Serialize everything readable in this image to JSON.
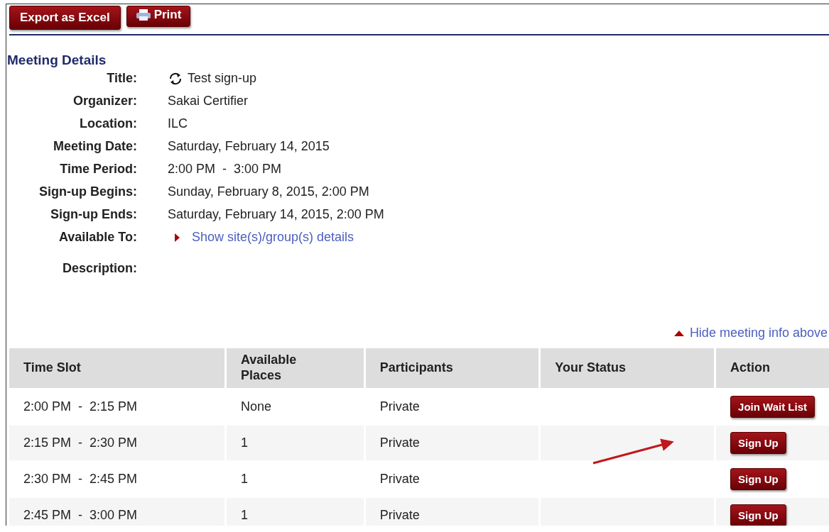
{
  "toolbar": {
    "buttons": [
      {
        "label": "Export as Excel",
        "kind": "plain"
      },
      {
        "label": "Print",
        "kind": "print"
      }
    ]
  },
  "meeting_details": {
    "heading": "Meeting Details",
    "fields": [
      {
        "label": "Title:",
        "value": "Test sign-up",
        "kind": "recurring"
      },
      {
        "label": "Organizer:",
        "value": "Sakai Certifier",
        "kind": "text"
      },
      {
        "label": "Location:",
        "value": "ILC",
        "kind": "text"
      },
      {
        "label": "Meeting Date:",
        "value": "Saturday, February 14, 2015",
        "kind": "text"
      },
      {
        "label": "Time Period:",
        "value": "2:00 PM  -  3:00 PM",
        "kind": "text"
      },
      {
        "label": "Sign-up Begins:",
        "value": "Sunday, February 8, 2015, 2:00 PM",
        "kind": "text"
      },
      {
        "label": "Sign-up Ends:",
        "value": "Saturday, February 14, 2015, 2:00 PM",
        "kind": "text"
      },
      {
        "label": "Available To:",
        "value": "Show site(s)/group(s) details",
        "kind": "toggle",
        "expanded": false
      },
      {
        "label": "Description:",
        "kind": "description"
      }
    ]
  },
  "hide_link": "Hide meeting info above",
  "table": {
    "columns": [
      "Time Slot",
      "Available\nPlaces",
      "Participants",
      "Your Status",
      "Action"
    ],
    "rows": [
      {
        "time_slot": "2:00 PM  -  2:15 PM",
        "available_places": "None",
        "participants": "Private",
        "action": "Join Wait List"
      },
      {
        "time_slot": "2:15 PM  -  2:30 PM",
        "available_places": "1",
        "participants": "Private",
        "action": "Sign Up"
      },
      {
        "time_slot": "2:30 PM  -  2:45 PM",
        "available_places": "1",
        "participants": "Private",
        "action": "Sign Up"
      },
      {
        "time_slot": "2:45 PM  -  3:00 PM",
        "available_places": "1",
        "participants": "Private",
        "action": "Sign Up"
      }
    ]
  }
}
